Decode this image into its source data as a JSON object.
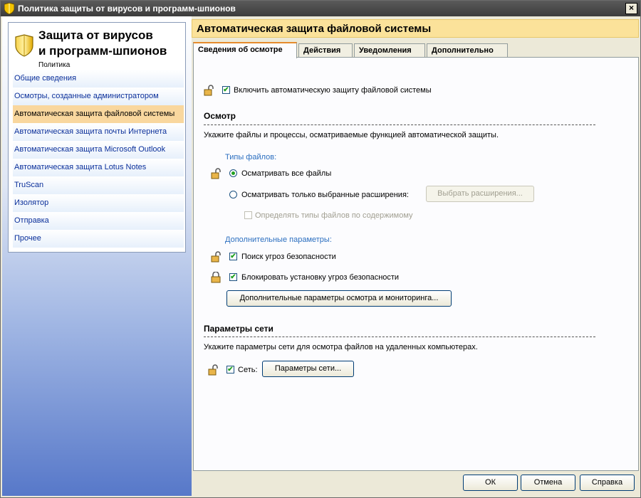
{
  "window": {
    "title": "Политика защиты от вирусов и программ-шпионов",
    "close_label": "×"
  },
  "sidebar": {
    "brand_title_line1": "Защита от вирусов",
    "brand_title_line2": "и программ-шпионов",
    "brand_subtitle": "Политика",
    "items": [
      {
        "label": "Общие сведения"
      },
      {
        "label": "Осмотры, созданные администратором"
      },
      {
        "label": "Автоматическая защита файловой системы"
      },
      {
        "label": "Автоматическая защита почты Интернета"
      },
      {
        "label": "Автоматическая защита Microsoft Outlook"
      },
      {
        "label": "Автоматическая защита Lotus Notes"
      },
      {
        "label": "TruScan"
      },
      {
        "label": "Изолятор"
      },
      {
        "label": "Отправка"
      },
      {
        "label": "Прочее"
      }
    ],
    "active_index": 2
  },
  "main": {
    "header_title": "Автоматическая защита файловой системы",
    "tabs": [
      {
        "label": "Сведения об осмотре"
      },
      {
        "label": "Действия"
      },
      {
        "label": "Уведомления"
      },
      {
        "label": "Дополнительно"
      }
    ],
    "active_tab": 0,
    "enable_autoprotect": {
      "label": "Включить автоматическую защиту файловой системы",
      "checked": true
    },
    "scan": {
      "section_title": "Осмотр",
      "description": "Укажите файлы и процессы, осматриваемые функцией автоматической защиты.",
      "file_types_label": "Типы файлов:",
      "all_files_label": "Осматривать все файлы",
      "selected_ext_label": "Осматривать только выбранные расширения:",
      "choose_ext_button": "Выбрать расширения...",
      "detect_by_content_label": "Определять типы файлов по содержимому",
      "extra_params_label": "Дополнительные параметры:",
      "threat_search_label": "Поиск угроз безопасности",
      "block_install_label": "Блокировать установку угроз безопасности",
      "advanced_button": "Дополнительные параметры осмотра и мониторинга..."
    },
    "network": {
      "section_title": "Параметры сети",
      "description": "Укажите параметры сети для осмотра файлов на удаленных компьютерах.",
      "network_label": "Сеть:",
      "network_button": "Параметры сети..."
    }
  },
  "footer": {
    "ok_label": "ОК",
    "cancel_label": "Отмена",
    "help_label": "Справка"
  },
  "colors": {
    "accent_header": "#fbe29a",
    "active_nav": "#f9d79e",
    "link_blue": "#0a2f9a",
    "check_green": "#21a121",
    "tab_highlight": "#e68b2c"
  }
}
